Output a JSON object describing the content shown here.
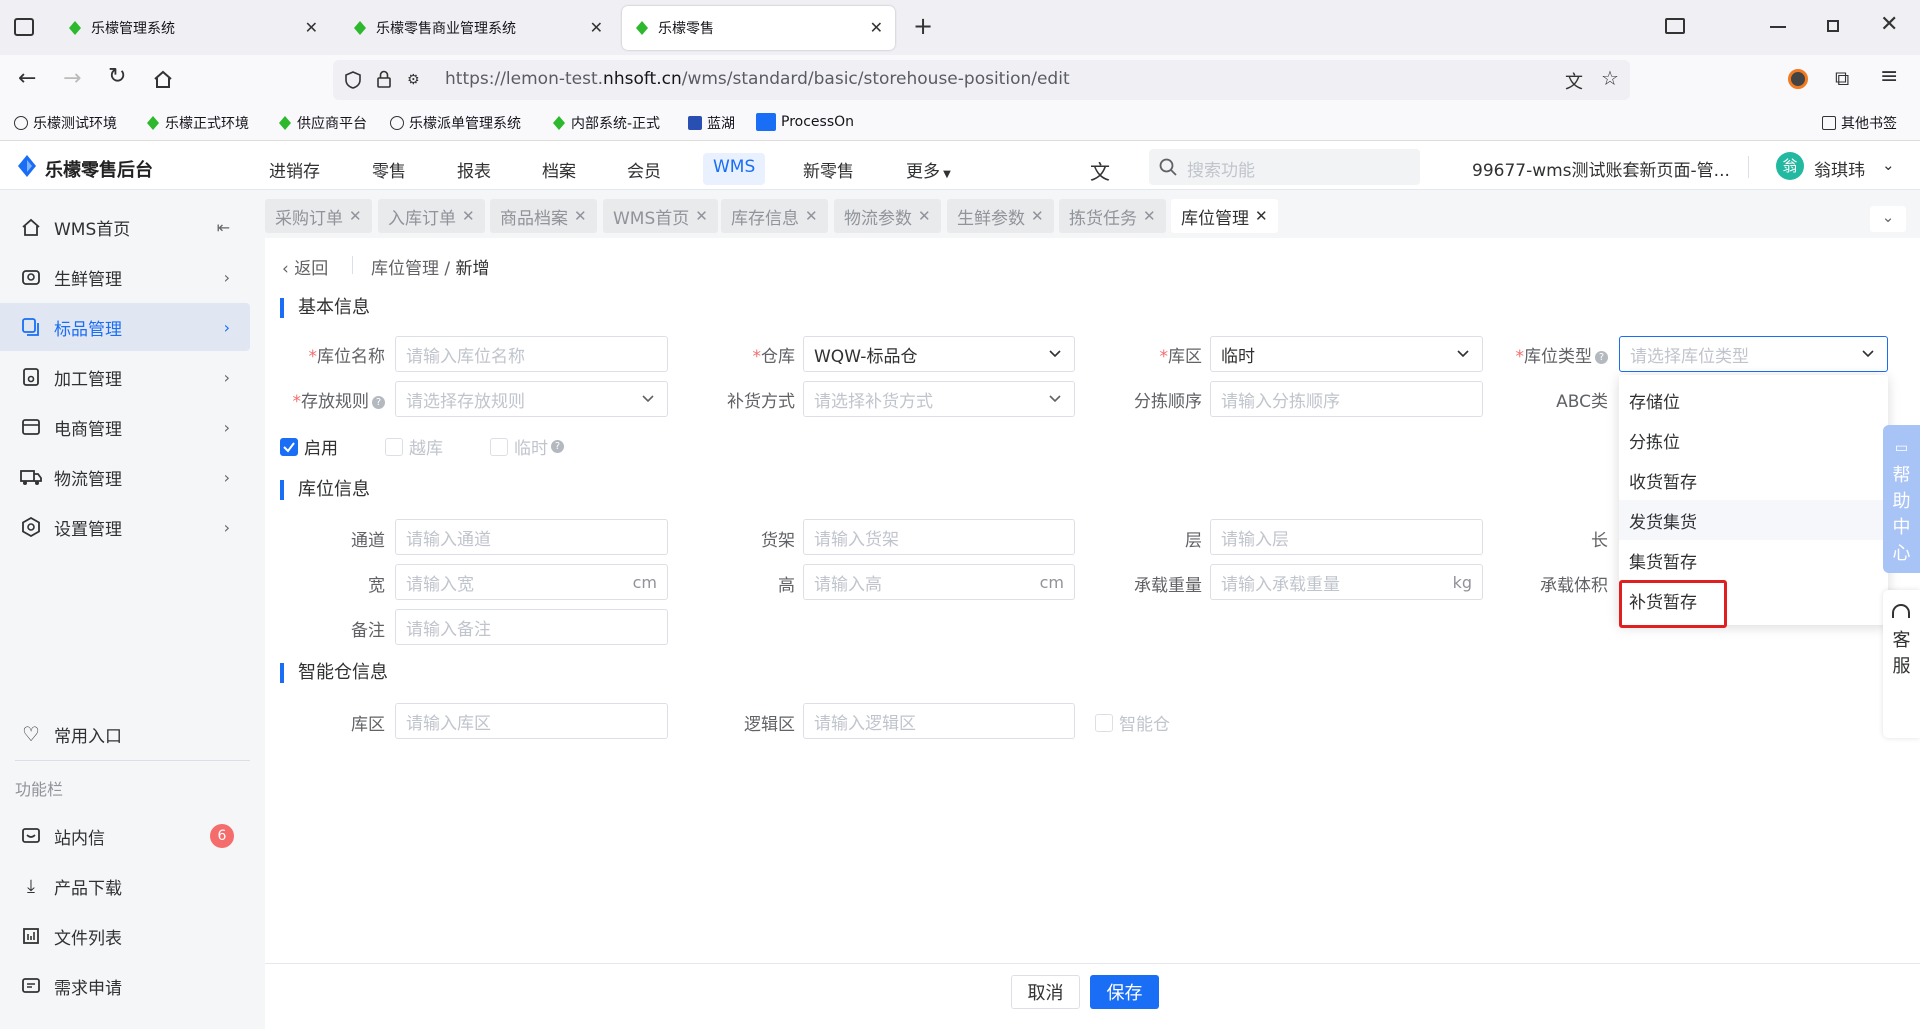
{
  "browser": {
    "tabs": [
      {
        "title": "乐檬管理系统"
      },
      {
        "title": "乐檬零售商业管理系统"
      },
      {
        "title": "乐檬零售"
      }
    ],
    "url_prefix": "https://lemon-test.",
    "url_domain": "nhsoft.cn",
    "url_path": "/wms/standard/basic/storehouse-position/edit",
    "bookmarks": [
      "乐檬测试环境",
      "乐檬正式环境",
      "供应商平台",
      "乐檬派单管理系统",
      "内部系统-正式",
      "蓝湖",
      "ProcessOn"
    ],
    "other_bookmarks": "其他书签"
  },
  "app": {
    "logo": "乐檬零售后台",
    "nav": [
      "进销存",
      "零售",
      "报表",
      "档案",
      "会员",
      "WMS",
      "新零售",
      "更多"
    ],
    "search_placeholder": "搜索功能",
    "account": "99677-wms测试账套新页面-管...",
    "avatar_char": "翁",
    "user": "翁琪玮"
  },
  "sidebar": {
    "items": [
      "WMS首页",
      "生鲜管理",
      "标品管理",
      "加工管理",
      "电商管理",
      "物流管理",
      "设置管理"
    ],
    "common": "常用入口",
    "func_title": "功能栏",
    "func_items": [
      "站内信",
      "产品下载",
      "文件列表",
      "需求申请"
    ],
    "msg_badge": "6"
  },
  "page_tabs": [
    "采购订单",
    "入库订单",
    "商品档案",
    "WMS首页",
    "库存信息",
    "物流参数",
    "生鲜参数",
    "拣货任务",
    "库位管理"
  ],
  "breadcrumb": {
    "back": "返回",
    "parent": "库位管理",
    "current": "新增"
  },
  "sections": {
    "basic": "基本信息",
    "position": "库位信息",
    "smart": "智能仓信息"
  },
  "form": {
    "name_label": "库位名称",
    "name_ph": "请输入库位名称",
    "warehouse_label": "仓库",
    "warehouse_val": "WQW-标品仓",
    "zone_label": "库区",
    "zone_val": "临时",
    "type_label": "库位类型",
    "type_ph": "请选择库位类型",
    "rule_label": "存放规则",
    "rule_ph": "请选择存放规则",
    "replenish_label": "补货方式",
    "replenish_ph": "请选择补货方式",
    "pick_label": "分拣顺序",
    "pick_ph": "请输入分拣顺序",
    "abc_label": "ABC类",
    "enable": "启用",
    "cross": "越库",
    "temp": "临时",
    "aisle_label": "通道",
    "aisle_ph": "请输入通道",
    "shelf_label": "货架",
    "shelf_ph": "请输入货架",
    "layer_label": "层",
    "layer_ph": "请输入层",
    "length_label": "长",
    "width_label": "宽",
    "width_ph": "请输入宽",
    "height_label": "高",
    "height_ph": "请输入高",
    "weight_label": "承载重量",
    "weight_ph": "请输入承载重量",
    "volume_label": "承载体积",
    "unit_cm": "cm",
    "unit_kg": "kg",
    "remark_label": "备注",
    "remark_ph": "请输入备注",
    "szone_label": "库区",
    "szone_ph": "请输入库区",
    "logic_label": "逻辑区",
    "logic_ph": "请输入逻辑区",
    "smart_label": "智能仓"
  },
  "dropdown": [
    "存储位",
    "分拣位",
    "收货暂存",
    "发货集货",
    "集货暂存",
    "补货暂存"
  ],
  "footer": {
    "cancel": "取消",
    "save": "保存"
  },
  "side_widgets": {
    "help": [
      "帮",
      "助",
      "中",
      "心"
    ],
    "service": [
      "客",
      "服"
    ]
  }
}
